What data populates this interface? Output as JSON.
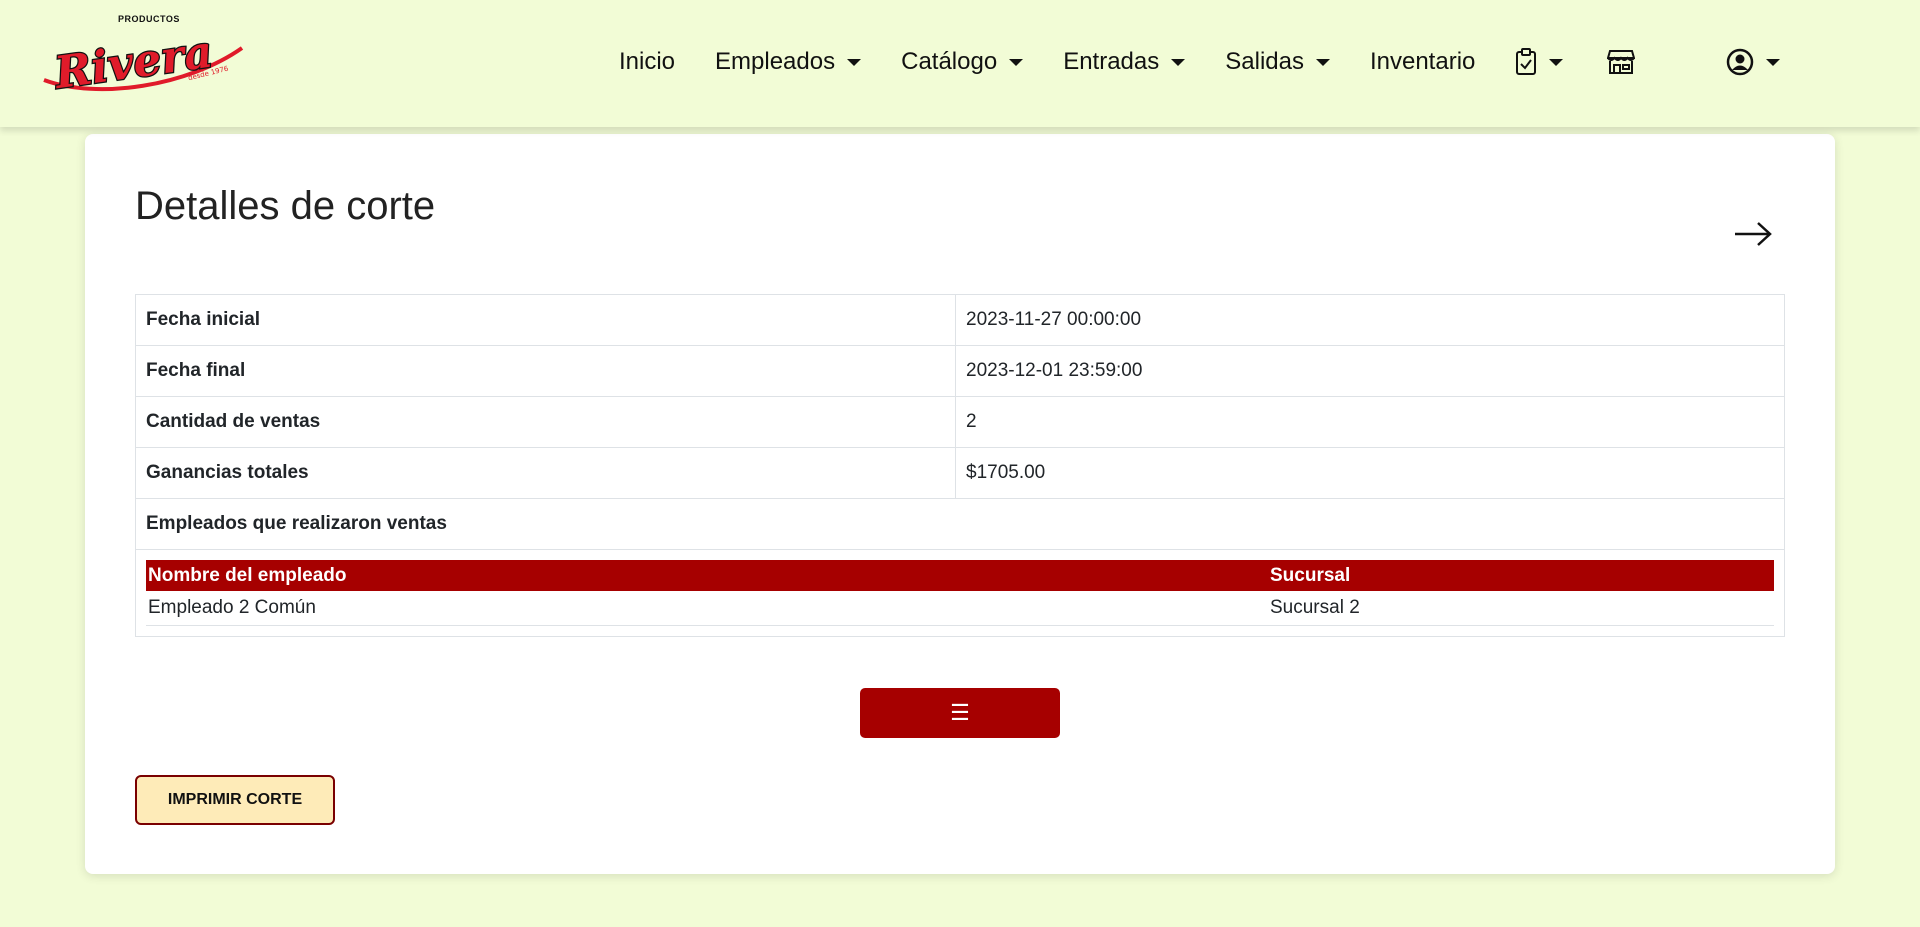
{
  "brand": {
    "top_text": "PRODUCTOS",
    "name": "Rivera",
    "tagline": "desde 1976"
  },
  "nav": {
    "items": [
      {
        "label": "Inicio",
        "dropdown": false
      },
      {
        "label": "Empleados",
        "dropdown": true
      },
      {
        "label": "Catálogo",
        "dropdown": true
      },
      {
        "label": "Entradas",
        "dropdown": true
      },
      {
        "label": "Salidas",
        "dropdown": true
      },
      {
        "label": "Inventario",
        "dropdown": false
      }
    ],
    "icons": [
      "clipboard-check-icon",
      "shop-icon",
      "user-circle-icon"
    ]
  },
  "page": {
    "title": "Detalles de corte"
  },
  "details": {
    "rows": [
      {
        "label": "Fecha inicial",
        "value": "2023-11-27 00:00:00"
      },
      {
        "label": "Fecha final",
        "value": "2023-12-01 23:59:00"
      },
      {
        "label": "Cantidad de ventas",
        "value": "2"
      },
      {
        "label": "Ganancias totales",
        "value": "$1705.00"
      }
    ],
    "employees_label": "Empleados que realizaron ventas",
    "employees_table": {
      "headers": [
        "Nombre del empleado",
        "Sucursal"
      ],
      "rows": [
        [
          "Empleado 2 Común",
          "Sucursal 2"
        ]
      ]
    }
  },
  "buttons": {
    "menu_symbol": "☰",
    "print_label": "IMPRIMIR CORTE"
  },
  "colors": {
    "accent": "#a60000",
    "background": "#f2fcd6",
    "print_button": "#feebb8"
  }
}
